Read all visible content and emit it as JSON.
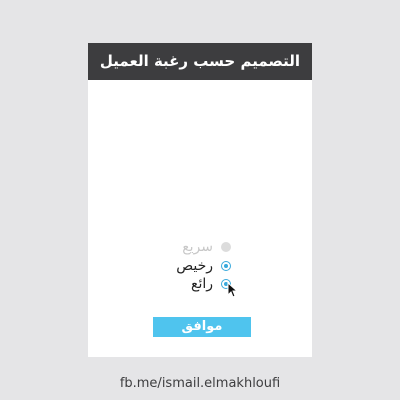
{
  "card": {
    "title": "التصميم حسب رغبة العميل"
  },
  "options": [
    {
      "label": "سريع",
      "state": "disabled"
    },
    {
      "label": "رخيص",
      "state": "selected"
    },
    {
      "label": "رائع",
      "state": "selected"
    }
  ],
  "ok_button": {
    "label": "موافق"
  },
  "footer": {
    "link": "fb.me/ismail.elmakhloufi"
  },
  "colors": {
    "background": "#e5e5e7",
    "header": "#3d3d3f",
    "accent": "#39a9dc",
    "button": "#4fc4ee"
  },
  "icons": {
    "cursor": "pointer-cursor-icon"
  }
}
